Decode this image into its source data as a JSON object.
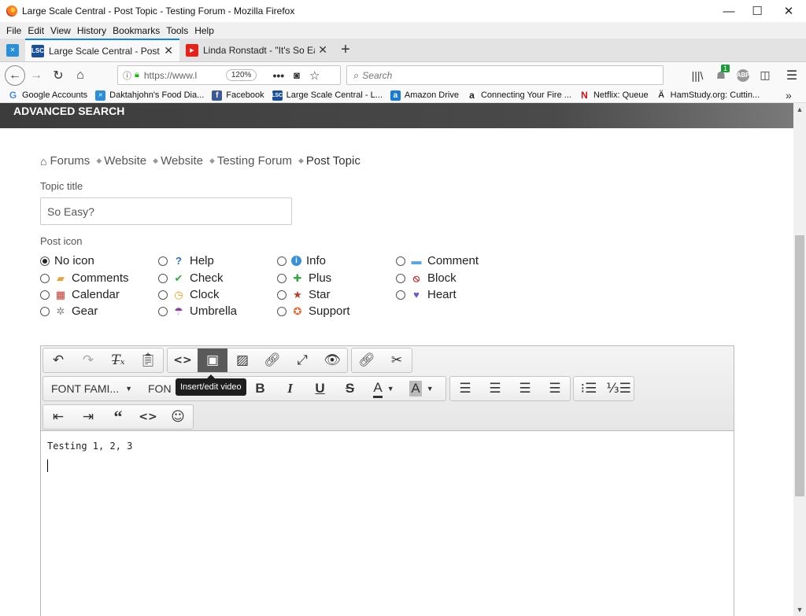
{
  "window": {
    "title": "Large Scale Central - Post Topic - Testing Forum - Mozilla Firefox",
    "controls": {
      "minimize": "—",
      "maximize": "☐",
      "close": "✕"
    }
  },
  "menubar": [
    "File",
    "Edit",
    "View",
    "History",
    "Bookmarks",
    "Tools",
    "Help"
  ],
  "tabs": [
    {
      "label": "Large Scale Central - Post Topic",
      "favicon": "LSC",
      "favicon_color": "#1a4fa0",
      "active": true
    },
    {
      "label": "Linda Ronstadt - \"It's So Easy\" (",
      "favicon": "▶",
      "favicon_color": "#e62117",
      "active": false
    }
  ],
  "navbar": {
    "url": "https://www.l",
    "zoom": "120%",
    "search_placeholder": "Search",
    "notification_badge": "1"
  },
  "bookmarks": [
    {
      "label": "Google Accounts",
      "icon": "G",
      "color": "#4285f4"
    },
    {
      "label": "Daktahjohn's Food Dia...",
      "icon": "D",
      "color": "#2a8fd8"
    },
    {
      "label": "Facebook",
      "icon": "f",
      "color": "#3b5998"
    },
    {
      "label": "Large Scale Central - L...",
      "icon": "LSC",
      "color": "#1a4fa0"
    },
    {
      "label": "Amazon Drive",
      "icon": "a",
      "color": "#1a7bd6"
    },
    {
      "label": "Connecting Your Fire ...",
      "icon": "a",
      "color": "#222"
    },
    {
      "label": "Netflix: Queue",
      "icon": "N",
      "color": "#e50914"
    },
    {
      "label": "HamStudy.org: Cuttin...",
      "icon": "Ä",
      "color": "#555"
    }
  ],
  "page": {
    "banner": "ADVANCED SEARCH",
    "breadcrumb": [
      "Forums",
      "Website",
      "Website",
      "Testing Forum",
      "Post Topic"
    ],
    "topic_title_label": "Topic title",
    "topic_title_value": "So Easy?",
    "post_icon_label": "Post icon",
    "post_icons": [
      {
        "label": "No icon",
        "glyph": "",
        "color": "#000",
        "checked": true
      },
      {
        "label": "Help",
        "glyph": "?",
        "color": "#2b6cc4"
      },
      {
        "label": "Info",
        "glyph": "i",
        "color": "#3a8fd8"
      },
      {
        "label": "Comment",
        "glyph": "▬",
        "color": "#5aa6e0"
      },
      {
        "label": "Comments",
        "glyph": "▰",
        "color": "#e8a33a"
      },
      {
        "label": "Check",
        "glyph": "✔",
        "color": "#3aa64a"
      },
      {
        "label": "Plus",
        "glyph": "✚",
        "color": "#3aa64a"
      },
      {
        "label": "Block",
        "glyph": "⦸",
        "color": "#cc2222"
      },
      {
        "label": "Calendar",
        "glyph": "▦",
        "color": "#c0392b"
      },
      {
        "label": "Clock",
        "glyph": "◷",
        "color": "#e8a020"
      },
      {
        "label": "Star",
        "glyph": "★",
        "color": "#c0392b"
      },
      {
        "label": "Heart",
        "glyph": "♥",
        "color": "#6a5acd"
      },
      {
        "label": "Gear",
        "glyph": "✲",
        "color": "#888"
      },
      {
        "label": "Umbrella",
        "glyph": "☂",
        "color": "#8a3fa0"
      },
      {
        "label": "Support",
        "glyph": "✪",
        "color": "#e8642a"
      }
    ]
  },
  "editor": {
    "font_family_label": "FONT FAMI...",
    "font_size_label": "FON",
    "tooltip": "Insert/edit video",
    "content_line": "Testing 1, 2, 3"
  }
}
